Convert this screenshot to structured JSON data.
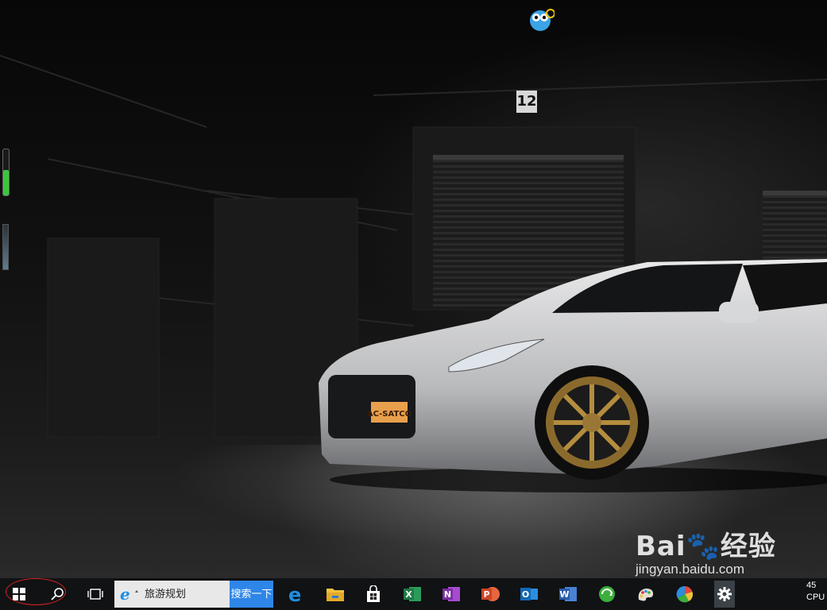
{
  "desktop": {
    "wall_number": "12",
    "license_plate": "AC-SATCO",
    "watermark_logo": "Bai🐾经验",
    "watermark_url": "jingyan.baidu.com",
    "gauge_level_percent": 55
  },
  "taskbar": {
    "search_address_text": "旅游规划",
    "search_button_label": "搜索一下",
    "apps": [
      {
        "name": "edge",
        "color": "#1f8fe0"
      },
      {
        "name": "file-explorer",
        "color": "#f2c23c"
      },
      {
        "name": "store",
        "color": "#ffffff"
      },
      {
        "name": "excel",
        "color": "#1f7a44"
      },
      {
        "name": "onenote",
        "color": "#7b2fa3"
      },
      {
        "name": "powerpoint",
        "color": "#d04423"
      },
      {
        "name": "outlook",
        "color": "#1268b3"
      },
      {
        "name": "word",
        "color": "#2a5bab"
      }
    ],
    "tray_line1": "45",
    "tray_line2": "CPU"
  }
}
